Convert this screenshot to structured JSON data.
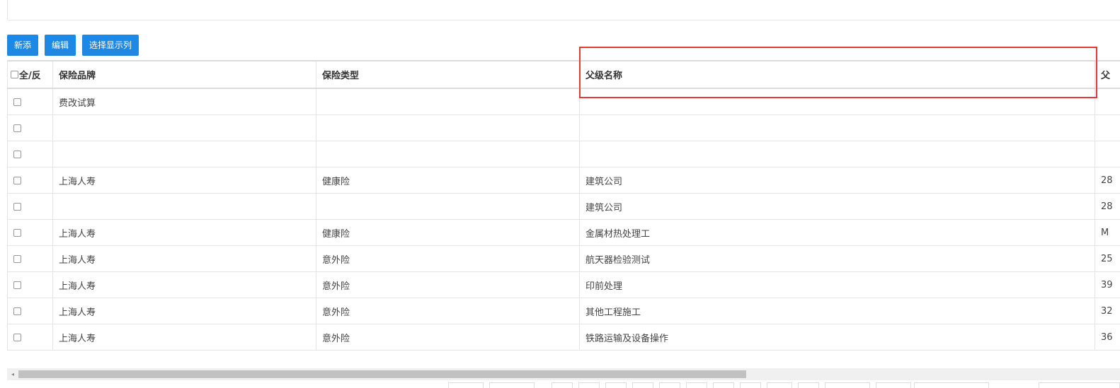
{
  "toolbar": {
    "add_label": "新添",
    "edit_label": "编辑",
    "columns_label": "选择显示列"
  },
  "table": {
    "select_all_label": "全/反",
    "headers": [
      "保险品牌",
      "保险类型",
      "父级名称",
      "父"
    ],
    "rows": [
      [
        "费改试算",
        "",
        "",
        ""
      ],
      [
        "",
        "",
        "",
        ""
      ],
      [
        "",
        "",
        "",
        ""
      ],
      [
        "上海人寿",
        "健康险",
        "建筑公司",
        "28"
      ],
      [
        "",
        "",
        "建筑公司",
        "28"
      ],
      [
        "上海人寿",
        "健康险",
        "金属材热处理工",
        "M"
      ],
      [
        "上海人寿",
        "意外险",
        "航天器检验测试",
        "25"
      ],
      [
        "上海人寿",
        "意外险",
        "印前处理",
        "39"
      ],
      [
        "上海人寿",
        "意外险",
        "其他工程施工",
        "32"
      ],
      [
        "上海人寿",
        "意外险",
        "铁路运输及设备操作",
        "36"
      ]
    ]
  },
  "scrollbar": {
    "left_arrow_glyph": "◂"
  }
}
